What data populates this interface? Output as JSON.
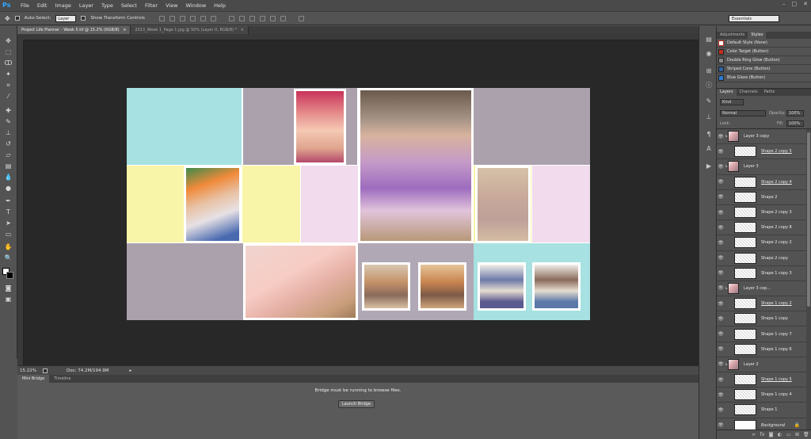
{
  "menubar": {
    "logo": "Ps",
    "items": [
      "File",
      "Edit",
      "Image",
      "Layer",
      "Type",
      "Select",
      "Filter",
      "View",
      "Window",
      "Help"
    ],
    "window_controls": [
      "–",
      "□",
      "✕"
    ]
  },
  "options": {
    "auto_select_label": "Auto-Select:",
    "auto_select_value": "Layer",
    "transform_label": "Show Transform Controls",
    "workspace": "Essentials"
  },
  "tabs": [
    {
      "label": "Project Life Planner - Week 5.tif @ 15.2% (RGB/8)",
      "close": "×"
    },
    {
      "label": "2013_Week 1_Page 1.jpg @ 50% (Layer 0, RGB/8) *",
      "close": "×"
    }
  ],
  "status": {
    "zoom": "15.22%",
    "doc": "Doc: 74.2M/194.9M",
    "arrow": "▸"
  },
  "bottom_panel": {
    "tabs": [
      "Mini Bridge",
      "Timeline"
    ],
    "message": "Bridge must be running to browse files.",
    "button": "Launch Bridge"
  },
  "styles_panel": {
    "tabs": [
      "Adjustments",
      "Styles"
    ],
    "items": [
      {
        "label": "Default Style (None)",
        "color": "#ffffff"
      },
      {
        "label": "Color Target (Button)",
        "color": "#c03020"
      },
      {
        "label": "Double Ring Glow (Button)",
        "color": "#888888"
      },
      {
        "label": "Striped Cone (Button)",
        "color": "#3060a0"
      },
      {
        "label": "Blue Glass (Button)",
        "color": "#2a7ad0"
      }
    ]
  },
  "layers_panel": {
    "tabs": [
      "Layers",
      "Channels",
      "Paths"
    ],
    "kind": "Kind",
    "blend_mode": "Normal",
    "opacity_label": "Opacity:",
    "opacity_value": "100%",
    "lock_label": "Lock:",
    "fill_label": "Fill:",
    "fill_value": "100%",
    "layers": [
      {
        "name": "Layer 3 copy",
        "style": "normal",
        "photo": true,
        "link": true
      },
      {
        "name": "Shape 2 copy 5",
        "style": "underline",
        "photo": false,
        "link": false
      },
      {
        "name": "Layer 3",
        "style": "normal",
        "photo": true,
        "link": true
      },
      {
        "name": "Shape 2 copy 4",
        "style": "underline",
        "photo": false,
        "link": false
      },
      {
        "name": "Shape 2",
        "style": "normal",
        "photo": false,
        "link": false
      },
      {
        "name": "Shape 2 copy 3",
        "style": "normal",
        "photo": false,
        "link": false
      },
      {
        "name": "Shape 2 copy 8",
        "style": "normal",
        "photo": false,
        "link": false
      },
      {
        "name": "Shape 2 copy 2",
        "style": "normal",
        "photo": false,
        "link": false
      },
      {
        "name": "Shape 2 copy",
        "style": "normal",
        "photo": false,
        "link": false
      },
      {
        "name": "Shape 1 copy 3",
        "style": "normal",
        "photo": false,
        "link": false
      },
      {
        "name": "Layer 3 cop...",
        "style": "normal",
        "photo": true,
        "link": true
      },
      {
        "name": "Shape 1 copy 2",
        "style": "underline",
        "photo": false,
        "link": false
      },
      {
        "name": "Shape 1 copy",
        "style": "normal",
        "photo": false,
        "link": false
      },
      {
        "name": "Shape 1 copy 7",
        "style": "normal",
        "photo": false,
        "link": false
      },
      {
        "name": "Shape 1 copy 6",
        "style": "normal",
        "photo": false,
        "link": false
      },
      {
        "name": "Layer 2",
        "style": "normal",
        "photo": true,
        "link": true
      },
      {
        "name": "Shape 1 copy 5",
        "style": "underline",
        "photo": false,
        "link": false
      },
      {
        "name": "Shape 1 copy 4",
        "style": "normal",
        "photo": false,
        "link": false
      },
      {
        "name": "Shape 1",
        "style": "normal",
        "photo": false,
        "link": false
      },
      {
        "name": "Background",
        "style": "italic",
        "photo": false,
        "link": false,
        "locked": true
      }
    ]
  },
  "colors": {
    "aqua": "#a7e1e1",
    "grey": "#aaa1ad",
    "yellow": "#f8f5a8",
    "pink": "#f1dbec",
    "mauve": "#b1a8b5"
  }
}
